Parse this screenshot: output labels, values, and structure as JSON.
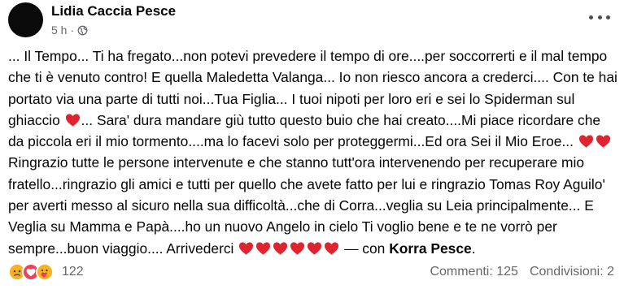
{
  "post": {
    "author": "Lidia Caccia Pesce",
    "time": "5 h",
    "separator": "·",
    "icons": {
      "avatar": "avatar",
      "privacy": "globe-icon",
      "menu": "more-options-icon",
      "heart": "red-heart-emoji"
    },
    "colors": {
      "heart": "#e0242f",
      "meta": "#65676b"
    },
    "text": {
      "p1": "... Il Tempo... Ti ha fregato...non potevi prevedere il tempo di ore....per soccorrerti e il mal tempo che ti è venuto contro! E quella Maledetta Valanga... Io non riesco ancora a crederci.... Con te hai portato via una parte di tutti noi...Tua Figlia... I tuoi nipoti per loro eri e sei lo Spiderman sul ghiaccio ",
      "p2": "... Sara' dura mandare giù tutto questo buio che hai creato....Mi piace ricordare che da piccola eri il mio tormento....ma lo facevi solo per proteggermi...Ed ora Sei il Mio Eroe... ",
      "p3": " Ringrazio tutte le persone intervenute e che stanno tutt'ora intervenendo per recuperare mio fratello...ringrazio gli amici e tutti per quello che avete fatto per lui e ringrazio Tomas Roy Aguilo' per averti messo al sicuro nella sua difficoltà...che di Corra...veglia su Leia principalmente... E Veglia su Mamma e Papà....ho un nuovo Angelo in cielo Ti voglio bene e te ne vorrò per sempre...buon viaggio.... Arrivederci ",
      "p4": " — con ",
      "tagged": "Korra Pesce",
      "end": "."
    }
  },
  "footer": {
    "reactions": [
      "sad-reaction-icon",
      "love-reaction-icon",
      "care-reaction-icon"
    ],
    "reaction_count": "122",
    "comments": "Commenti: 125",
    "shares": "Condivisioni: 2"
  }
}
